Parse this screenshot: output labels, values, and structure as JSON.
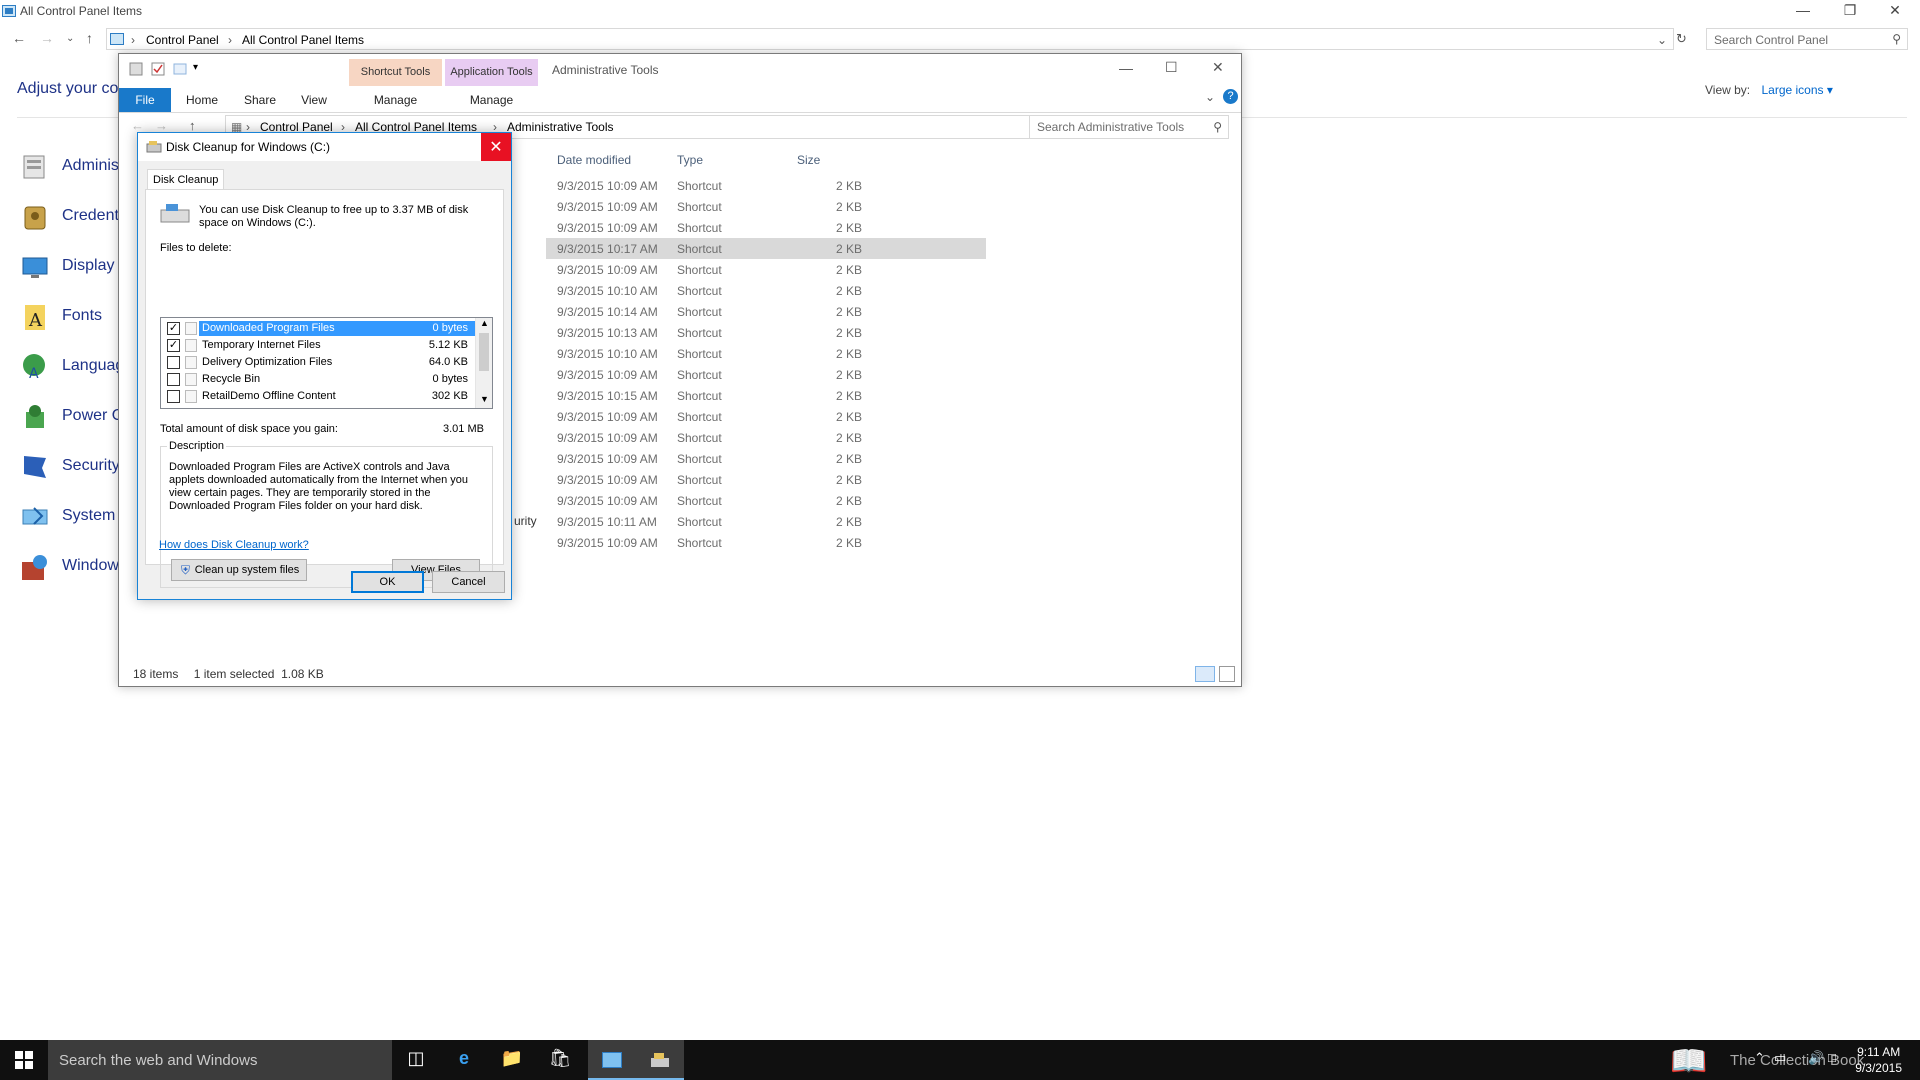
{
  "control_panel": {
    "title": "All Control Panel Items",
    "breadcrumb": [
      "Control Panel",
      "All Control Panel Items"
    ],
    "search_placeholder": "Search Control Panel",
    "heading": "Adjust your co",
    "view_by_label": "View by:",
    "view_by_value": "Large icons ▾",
    "items": [
      {
        "label": "Adminis",
        "icon": "admin-tools-icon"
      },
      {
        "label": "Credent",
        "icon": "credential-manager-icon"
      },
      {
        "label": "Display",
        "icon": "display-icon"
      },
      {
        "label": "Fonts",
        "icon": "fonts-icon"
      },
      {
        "label": "Languag",
        "icon": "language-icon"
      },
      {
        "label": "Power O",
        "icon": "power-options-icon"
      },
      {
        "label": "Security",
        "icon": "security-flag-icon"
      },
      {
        "label": "System",
        "icon": "system-icon"
      },
      {
        "label": "Window",
        "icon": "windows-firewall-icon"
      }
    ]
  },
  "explorer": {
    "title": "Administrative Tools",
    "context_tabs": [
      {
        "label": "Shortcut Tools",
        "color": "#f7d6c3"
      },
      {
        "label": "Application Tools",
        "color": "#e8ccf2"
      }
    ],
    "ribbon_tabs": [
      "File",
      "Home",
      "Share",
      "View",
      "Manage",
      "Manage"
    ],
    "breadcrumb": [
      "Control Panel",
      "All Control Panel Items",
      "Administrative Tools"
    ],
    "search_placeholder": "Search Administrative Tools",
    "columns": [
      "Date modified",
      "Type",
      "Size"
    ],
    "rows": [
      {
        "date": "9/3/2015 10:09 AM",
        "type": "Shortcut",
        "size": "2 KB",
        "selected": false
      },
      {
        "date": "9/3/2015 10:09 AM",
        "type": "Shortcut",
        "size": "2 KB",
        "selected": false
      },
      {
        "date": "9/3/2015 10:09 AM",
        "type": "Shortcut",
        "size": "2 KB",
        "selected": false
      },
      {
        "date": "9/3/2015 10:17 AM",
        "type": "Shortcut",
        "size": "2 KB",
        "selected": true
      },
      {
        "date": "9/3/2015 10:09 AM",
        "type": "Shortcut",
        "size": "2 KB",
        "selected": false
      },
      {
        "date": "9/3/2015 10:10 AM",
        "type": "Shortcut",
        "size": "2 KB",
        "selected": false
      },
      {
        "date": "9/3/2015 10:14 AM",
        "type": "Shortcut",
        "size": "2 KB",
        "selected": false
      },
      {
        "date": "9/3/2015 10:13 AM",
        "type": "Shortcut",
        "size": "2 KB",
        "selected": false
      },
      {
        "date": "9/3/2015 10:10 AM",
        "type": "Shortcut",
        "size": "2 KB",
        "selected": false
      },
      {
        "date": "9/3/2015 10:09 AM",
        "type": "Shortcut",
        "size": "2 KB",
        "selected": false
      },
      {
        "date": "9/3/2015 10:15 AM",
        "type": "Shortcut",
        "size": "2 KB",
        "selected": false
      },
      {
        "date": "9/3/2015 10:09 AM",
        "type": "Shortcut",
        "size": "2 KB",
        "selected": false
      },
      {
        "date": "9/3/2015 10:09 AM",
        "type": "Shortcut",
        "size": "2 KB",
        "selected": false
      },
      {
        "date": "9/3/2015 10:09 AM",
        "type": "Shortcut",
        "size": "2 KB",
        "selected": false
      },
      {
        "date": "9/3/2015 10:09 AM",
        "type": "Shortcut",
        "size": "2 KB",
        "selected": false
      },
      {
        "date": "9/3/2015 10:09 AM",
        "type": "Shortcut",
        "size": "2 KB",
        "selected": false
      },
      {
        "date": "9/3/2015 10:11 AM",
        "type": "Shortcut",
        "size": "2 KB",
        "selected": false
      },
      {
        "date": "9/3/2015 10:09 AM",
        "type": "Shortcut",
        "size": "2 KB",
        "selected": false
      }
    ],
    "partial_name": "urity",
    "status_items": "18 items",
    "status_selected": "1 item selected  1.08 KB"
  },
  "dialog": {
    "title": "Disk Cleanup for Windows (C:)",
    "tab": "Disk Cleanup",
    "intro": "You can use Disk Cleanup to free up to 3.37 MB of disk space on Windows (C:).",
    "files_label": "Files to delete:",
    "files": [
      {
        "name": "Downloaded Program Files",
        "size": "0 bytes",
        "checked": true,
        "selected": true
      },
      {
        "name": "Temporary Internet Files",
        "size": "5.12 KB",
        "checked": true,
        "selected": false
      },
      {
        "name": "Delivery Optimization Files",
        "size": "64.0 KB",
        "checked": false,
        "selected": false
      },
      {
        "name": "Recycle Bin",
        "size": "0 bytes",
        "checked": false,
        "selected": false
      },
      {
        "name": "RetailDemo Offline Content",
        "size": "302 KB",
        "checked": false,
        "selected": false
      }
    ],
    "total_label": "Total amount of disk space you gain:",
    "total_value": "3.01 MB",
    "description_label": "Description",
    "description": "Downloaded Program Files are ActiveX controls and Java applets downloaded automatically from the Internet when you view certain pages. They are temporarily stored in the Downloaded Program Files folder on your hard disk.",
    "cleanup_button": "Clean up system files",
    "view_button": "View Files",
    "help_link": "How does Disk Cleanup work?",
    "ok": "OK",
    "cancel": "Cancel"
  },
  "taskbar": {
    "search_placeholder": "Search the web and Windows",
    "time": "9:11 AM",
    "date": "9/3/2015",
    "watermark": "The Collection Book"
  }
}
